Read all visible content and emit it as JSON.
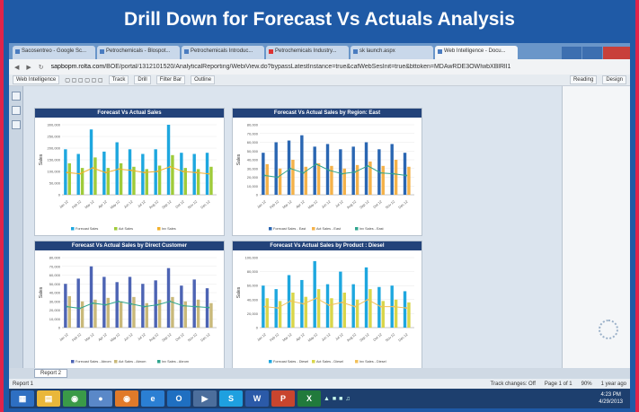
{
  "banner": {
    "title": "Drill Down for Forecast Vs Actuals Analysis"
  },
  "browser": {
    "tabs": [
      {
        "label": "Sacosentreo - Google Sc..."
      },
      {
        "label": "Petrochemicals - Blospot..."
      },
      {
        "label": "Petrochemicals Introduc..."
      },
      {
        "label": "Petrochemicals Industry..."
      },
      {
        "label": "sk launch.aspx"
      },
      {
        "label": "Web Intelligence - Docu..."
      }
    ],
    "url_host": "sapbopm.rolta.com",
    "url_path": "/BOE/portal/1312101520/AnalyticalReporting/WebiView.do?bypassLatestInstance=true&cafWebSesInit=true&bttoken=MDAwRDE3OWIwbXBlRlI1",
    "back_icon": "back-arrow-icon",
    "forward_icon": "forward-arrow-icon",
    "reload_icon": "reload-icon"
  },
  "toolbar": {
    "app_menu": "Web Intelligence",
    "track": "Track",
    "drill": "Drill",
    "filter_bar": "Filter Bar",
    "outline": "Outline",
    "reading": "Reading",
    "design": "Design"
  },
  "charts": [
    {
      "title": "Forecast Vs Actual Sales",
      "ylabel": "Sales",
      "yticks": [
        "300,000",
        "250,000",
        "200,000",
        "150,000",
        "100,000",
        "50,000",
        "0"
      ],
      "legend": [
        "Forecast Sales",
        "Act Sales",
        "Inv Sales"
      ]
    },
    {
      "title": "Forecast Vs Actual Sales by Region: East",
      "ylabel": "Sales",
      "yticks": [
        "80,000",
        "70,000",
        "60,000",
        "50,000",
        "40,000",
        "30,000",
        "20,000",
        "10,000",
        "0"
      ],
      "legend": [
        "Forecast Sales - East",
        "Act Sales - East",
        "Inv Sales - East"
      ]
    },
    {
      "title": "Forecast Vs Actual Sales by Direct Customer",
      "ylabel": "Sales",
      "yticks": [
        "80,000",
        "70,000",
        "60,000",
        "50,000",
        "40,000",
        "30,000",
        "20,000",
        "10,000",
        "0"
      ],
      "legend": [
        "Forecast Sales - Abrom",
        "Act Sales - Abrom",
        "Inv Sales - Abrom"
      ]
    },
    {
      "title": "Forecast Vs Actual Sales by Product : Diesel",
      "ylabel": "Sales",
      "yticks": [
        "100,000",
        "80,000",
        "60,000",
        "40,000",
        "20,000",
        "0"
      ],
      "legend": [
        "Forecast Sales - Diesel",
        "Act Sales - Diesel",
        "Inv Sales - Diesel"
      ]
    }
  ],
  "chart_data": [
    {
      "type": "bar",
      "title": "Forecast Vs Actual Sales",
      "ylabel": "Sales",
      "ylim": [
        0,
        300000
      ],
      "categories": [
        "Jan 12",
        "Feb 12",
        "Mar 12",
        "Apr 12",
        "May 12",
        "Jun 12",
        "Jul 12",
        "Aug 12",
        "Sep 12",
        "Oct 12",
        "Nov 12",
        "Dec 12"
      ],
      "series": [
        {
          "name": "Forecast Sales",
          "values": [
            195000,
            175000,
            280000,
            185000,
            225000,
            195000,
            175000,
            195000,
            300000,
            180000,
            175000,
            180000
          ]
        },
        {
          "name": "Act Sales",
          "values": [
            135000,
            115000,
            160000,
            115000,
            135000,
            120000,
            110000,
            125000,
            170000,
            115000,
            110000,
            120000
          ]
        },
        {
          "name": "Inv Sales",
          "values": [
            95000,
            90000,
            115000,
            95000,
            110000,
            105000,
            95000,
            100000,
            120000,
            100000,
            95000,
            90000
          ]
        }
      ],
      "colors": [
        "#1ea7df",
        "#9fcb3a",
        "#f2b02a"
      ]
    },
    {
      "type": "bar",
      "title": "Forecast Vs Actual Sales by Region: East",
      "ylabel": "Sales",
      "ylim": [
        0,
        80000
      ],
      "categories": [
        "Jan 12",
        "Feb 12",
        "Mar 12",
        "Apr 12",
        "May 12",
        "Jun 12",
        "Jul 12",
        "Aug 12",
        "Sep 12",
        "Oct 12",
        "Nov 12",
        "Dec 12"
      ],
      "series": [
        {
          "name": "Forecast Sales - East",
          "values": [
            48000,
            60000,
            62000,
            68000,
            55000,
            58000,
            52000,
            55000,
            60000,
            52000,
            58000,
            48000
          ]
        },
        {
          "name": "Act Sales - East",
          "values": [
            35000,
            30000,
            40000,
            32000,
            36000,
            33000,
            30000,
            34000,
            38000,
            33000,
            40000,
            32000
          ]
        },
        {
          "name": "Inv Sales - East",
          "values": [
            22000,
            20000,
            30000,
            25000,
            35000,
            28000,
            24000,
            26000,
            33000,
            25000,
            24000,
            22000
          ]
        }
      ],
      "colors": [
        "#2a66b2",
        "#f4b24a",
        "#2fa58e"
      ]
    },
    {
      "type": "bar",
      "title": "Forecast Vs Actual Sales by Direct Customer",
      "ylabel": "Sales",
      "ylim": [
        0,
        80000
      ],
      "categories": [
        "Jan 12",
        "Feb 12",
        "Mar 12",
        "Apr 12",
        "May 12",
        "Jun 12",
        "Jul 12",
        "Aug 12",
        "Sep 12",
        "Oct 12",
        "Nov 12",
        "Dec 12"
      ],
      "series": [
        {
          "name": "Forecast Sales - Abrom",
          "values": [
            50000,
            56000,
            70000,
            58000,
            52000,
            58000,
            50000,
            54000,
            68000,
            48000,
            55000,
            45000
          ]
        },
        {
          "name": "Act Sales - Abrom",
          "values": [
            36000,
            30000,
            32000,
            34000,
            30000,
            35000,
            28000,
            32000,
            35000,
            30000,
            32000,
            28000
          ]
        },
        {
          "name": "Inv Sales - Abrom",
          "values": [
            24000,
            22000,
            28000,
            26000,
            30000,
            27000,
            24000,
            26000,
            30000,
            25000,
            24000,
            23000
          ]
        }
      ],
      "colors": [
        "#4d64b4",
        "#c9b97a",
        "#2fa58e"
      ]
    },
    {
      "type": "bar",
      "title": "Forecast Vs Actual Sales by Product : Diesel",
      "ylabel": "Sales",
      "ylim": [
        0,
        100000
      ],
      "categories": [
        "Jan 12",
        "Feb 12",
        "Mar 12",
        "Apr 12",
        "May 12",
        "Jun 12",
        "Jul 12",
        "Aug 12",
        "Sep 12",
        "Oct 12",
        "Nov 12",
        "Dec 12"
      ],
      "series": [
        {
          "name": "Forecast Sales - Diesel",
          "values": [
            60000,
            55000,
            75000,
            68000,
            95000,
            62000,
            80000,
            62000,
            86000,
            58000,
            60000,
            52000
          ]
        },
        {
          "name": "Act Sales - Diesel",
          "values": [
            42000,
            38000,
            50000,
            44000,
            55000,
            42000,
            50000,
            40000,
            55000,
            38000,
            40000,
            36000
          ]
        },
        {
          "name": "Inv Sales - Diesel",
          "values": [
            30000,
            28000,
            38000,
            34000,
            42000,
            32000,
            36000,
            30000,
            40000,
            30000,
            30000,
            28000
          ]
        }
      ],
      "colors": [
        "#1ea7df",
        "#d9d64a",
        "#f2c05a"
      ]
    }
  ],
  "report": {
    "tab_label": "Report 2",
    "page_selector": "Report 1"
  },
  "bottom": {
    "track_changes": "Track changes: Off",
    "page": "Page 1 of 1",
    "zoom": "90%",
    "last_refresh": "1 year ago"
  },
  "taskbar": {
    "time": "4:23 PM",
    "date": "4/29/2013",
    "apps": [
      "windows-icon",
      "explorer-icon",
      "chrome-icon",
      "sap-icon",
      "firefox-icon",
      "ie-icon",
      "outlook-icon",
      "media-icon",
      "skype-icon",
      "word-icon",
      "powerpoint-icon",
      "excel-icon"
    ]
  }
}
